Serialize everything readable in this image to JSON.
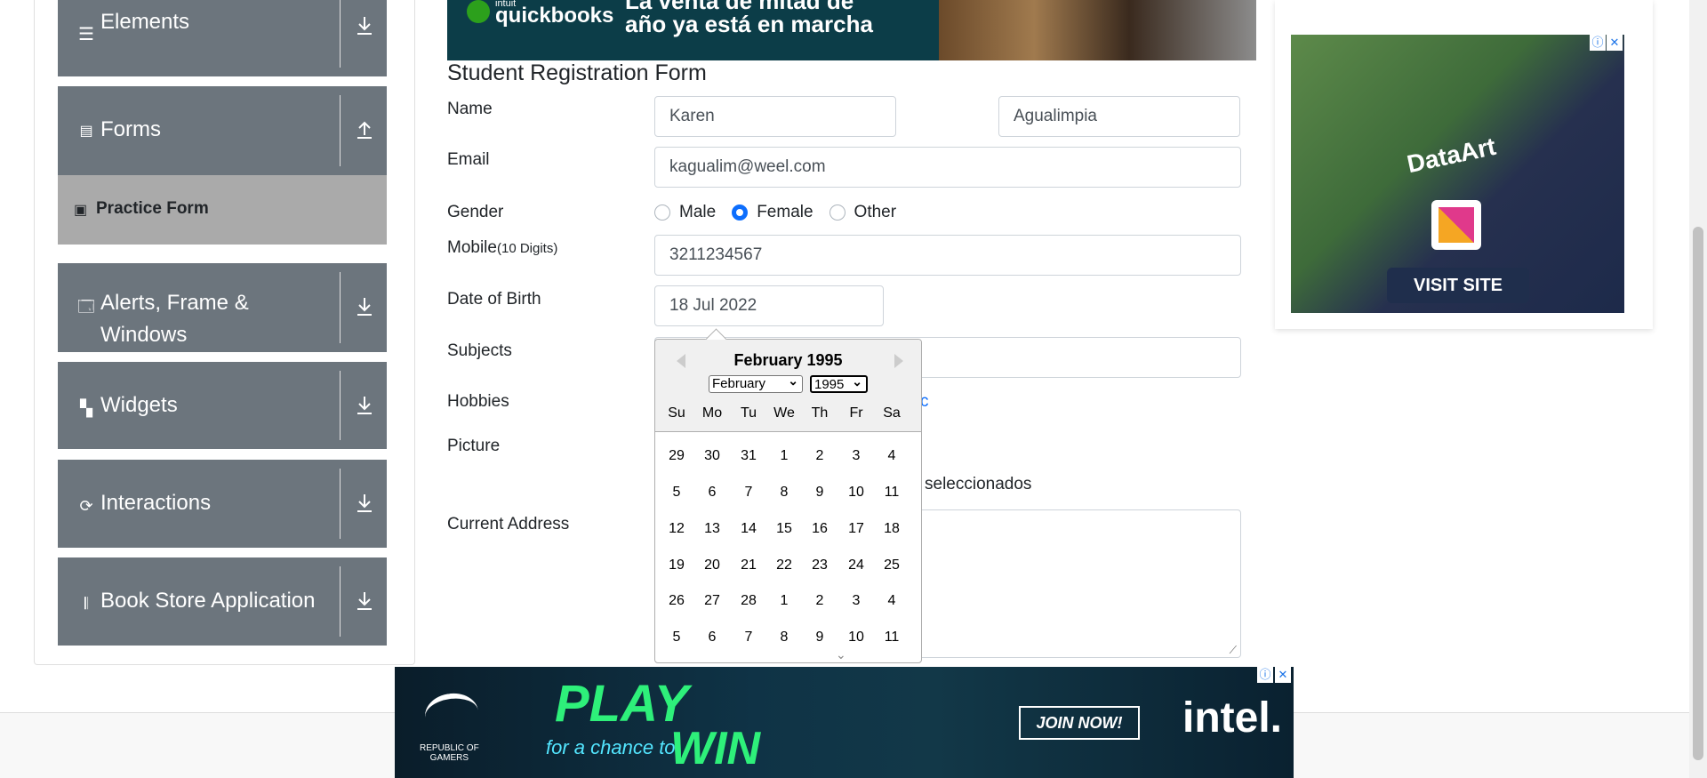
{
  "sidebar": {
    "groups": [
      {
        "label": "Elements",
        "icon": "hamburger-icon",
        "arrow": "down"
      },
      {
        "label": "Forms",
        "icon": "document-icon",
        "arrow": "up"
      },
      {
        "label": "Alerts, Frame &",
        "label2": "Windows",
        "icon": "window-icon",
        "arrow": "down"
      },
      {
        "label": "Widgets",
        "icon": "widgets-icon",
        "arrow": "down"
      },
      {
        "label": "Interactions",
        "icon": "interactions-icon",
        "arrow": "down"
      },
      {
        "label": "Book Store Application",
        "icon": "books-icon",
        "arrow": "down"
      }
    ],
    "active_item": "Practice Form"
  },
  "top_ad": {
    "brand_small": "intuit",
    "brand": "quickbooks",
    "line1": "La venta de mitad de",
    "line2": "año ya está en marcha"
  },
  "form": {
    "title": "Student Registration Form",
    "labels": {
      "name": "Name",
      "email": "Email",
      "gender": "Gender",
      "mobile": "Mobile",
      "mobile_hint": "(10 Digits)",
      "dob": "Date of Birth",
      "subjects": "Subjects",
      "hobbies": "Hobbies",
      "picture": "Picture",
      "address": "Current Address"
    },
    "first_name": "Karen",
    "last_name": "Agualimpia",
    "email": "kagualim@weel.com",
    "gender_options": [
      "Male",
      "Female",
      "Other"
    ],
    "gender_selected": "Female",
    "mobile": "3211234567",
    "dob": "18 Jul 2022",
    "hobbies_partial": "c",
    "picture_status": "seleccionados"
  },
  "datepicker": {
    "header": "February 1995",
    "month_select": "February",
    "year_select": "1995",
    "weekdays": [
      "Su",
      "Mo",
      "Tu",
      "We",
      "Th",
      "Fr",
      "Sa"
    ],
    "weeks": [
      [
        "29",
        "30",
        "31",
        "1",
        "2",
        "3",
        "4"
      ],
      [
        "5",
        "6",
        "7",
        "8",
        "9",
        "10",
        "11"
      ],
      [
        "12",
        "13",
        "14",
        "15",
        "16",
        "17",
        "18"
      ],
      [
        "19",
        "20",
        "21",
        "22",
        "23",
        "24",
        "25"
      ],
      [
        "26",
        "27",
        "28",
        "1",
        "2",
        "3",
        "4"
      ],
      [
        "5",
        "6",
        "7",
        "8",
        "9",
        "10",
        "11"
      ]
    ]
  },
  "right_ad": {
    "brand": "DataArt",
    "cta": "VISIT SITE"
  },
  "bottom_ad": {
    "brand_line1": "REPUBLIC OF",
    "brand_line2": "GAMERS",
    "play": "PLAY",
    "chance": "for a chance to",
    "win": "WIN",
    "cta": "JOIN NOW!",
    "intel": "intel."
  },
  "colors": {
    "sidebar_bg": "#6c757d",
    "active_bg": "#aaaaaa",
    "radio_accent": "#0d6efd"
  }
}
